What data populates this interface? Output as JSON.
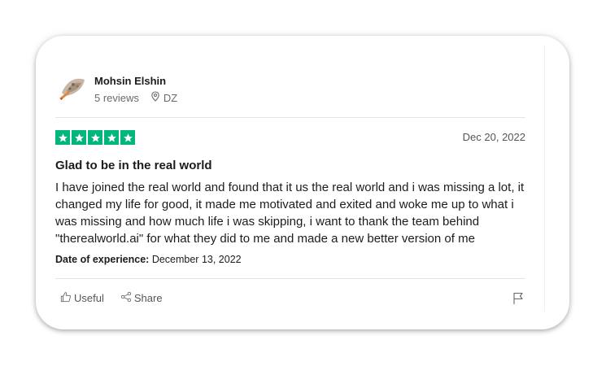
{
  "reviewer": {
    "name": "Mohsin Elshin",
    "reviews": "5 reviews",
    "country": "DZ"
  },
  "rating": {
    "stars": 5,
    "color": "#00b67a"
  },
  "review": {
    "date": "Dec 20, 2022",
    "title": "Glad to be in the real world",
    "body": "I have joined the real world and found that it us the real world and i was missing a lot, it changed my life for good, it made me motivated and exited and woke me up to what i was missing and how much life i was skipping, i want to thank the team behind \"therealworld.ai\" for what they did to me and made a new better version of me",
    "experience_label": "Date of experience:",
    "experience_date": "December 13, 2022"
  },
  "actions": {
    "useful_label": "Useful",
    "share_label": "Share"
  },
  "icons": [
    "thumbs-up-icon",
    "share-icon",
    "flag-icon",
    "location-pin-icon",
    "star-icon"
  ]
}
